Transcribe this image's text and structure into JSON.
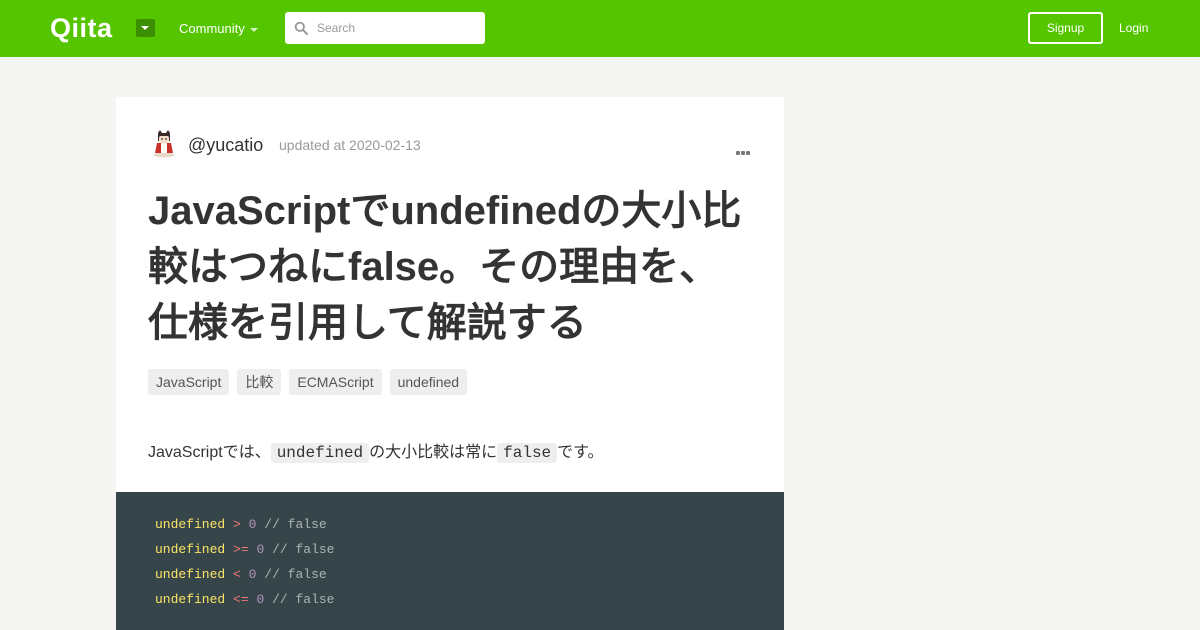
{
  "header": {
    "logo": "Qiita",
    "community_label": "Community",
    "search_placeholder": "Search",
    "search_value": "",
    "signup_label": "Signup",
    "login_label": "Login"
  },
  "article": {
    "author": "@yucatio",
    "updated": "updated at 2020-02-13",
    "title": "JavaScriptでundefinedの大小比較はつねにfalse。その理由を、仕様を引用して解説する",
    "tags": [
      "JavaScript",
      "比較",
      "ECMAScript",
      "undefined"
    ],
    "intro": {
      "part1": "JavaScriptでは、",
      "code1": "undefined",
      "part2": "の大小比較は常に",
      "code2": "false",
      "part3": "です。"
    },
    "code_lines": [
      {
        "kw": "undefined",
        "op": ">",
        "num": "0",
        "comment": "// false"
      },
      {
        "kw": "undefined",
        "op": ">=",
        "num": "0",
        "comment": "// false"
      },
      {
        "kw": "undefined",
        "op": "<",
        "num": "0",
        "comment": "// false"
      },
      {
        "kw": "undefined",
        "op": "<=",
        "num": "0",
        "comment": "// false"
      }
    ]
  },
  "colors": {
    "header_green": "#55c500",
    "code_bg": "#364549",
    "keyword": "#fce566",
    "operator": "#f2777a",
    "number": "#b294bb",
    "comment": "#aab4b7"
  },
  "icons": {
    "search": "search-icon",
    "dropdown": "caret-down-icon",
    "more": "more-dots-icon"
  }
}
